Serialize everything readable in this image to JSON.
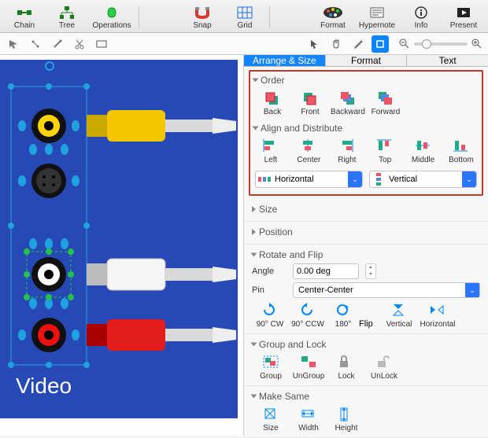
{
  "toolbar": {
    "chain": "Chain",
    "tree": "Tree",
    "operations": "Operations",
    "snap": "Snap",
    "grid": "Grid",
    "format": "Format",
    "hypernote": "Hypernote",
    "info": "Info",
    "present": "Present"
  },
  "tabs": {
    "arrange": "Arrange & Size",
    "format": "Format",
    "text": "Text"
  },
  "sections": {
    "order": {
      "title": "Order",
      "items": [
        "Back",
        "Front",
        "Backward",
        "Forward"
      ]
    },
    "align": {
      "title": "Align and Distribute",
      "items": [
        "Left",
        "Center",
        "Right",
        "Top",
        "Middle",
        "Bottom"
      ],
      "distribute": {
        "horizontal": "Horizontal",
        "vertical": "Vertical"
      }
    },
    "size": "Size",
    "position": "Position",
    "rotate": {
      "title": "Rotate and Flip",
      "angle_label": "Angle",
      "angle_value": "0.00 deg",
      "pin_label": "Pin",
      "pin_value": "Center-Center",
      "items": [
        "90° CW",
        "90° CCW",
        "180°"
      ],
      "flip_label": "Flip",
      "flip_items": [
        "Vertical",
        "Horizontal"
      ]
    },
    "group": {
      "title": "Group and Lock",
      "items": [
        "Group",
        "UnGroup",
        "Lock",
        "UnLock"
      ]
    },
    "same": {
      "title": "Make Same",
      "items": [
        "Size",
        "Width",
        "Height"
      ]
    }
  },
  "canvas": {
    "label": "Video"
  }
}
